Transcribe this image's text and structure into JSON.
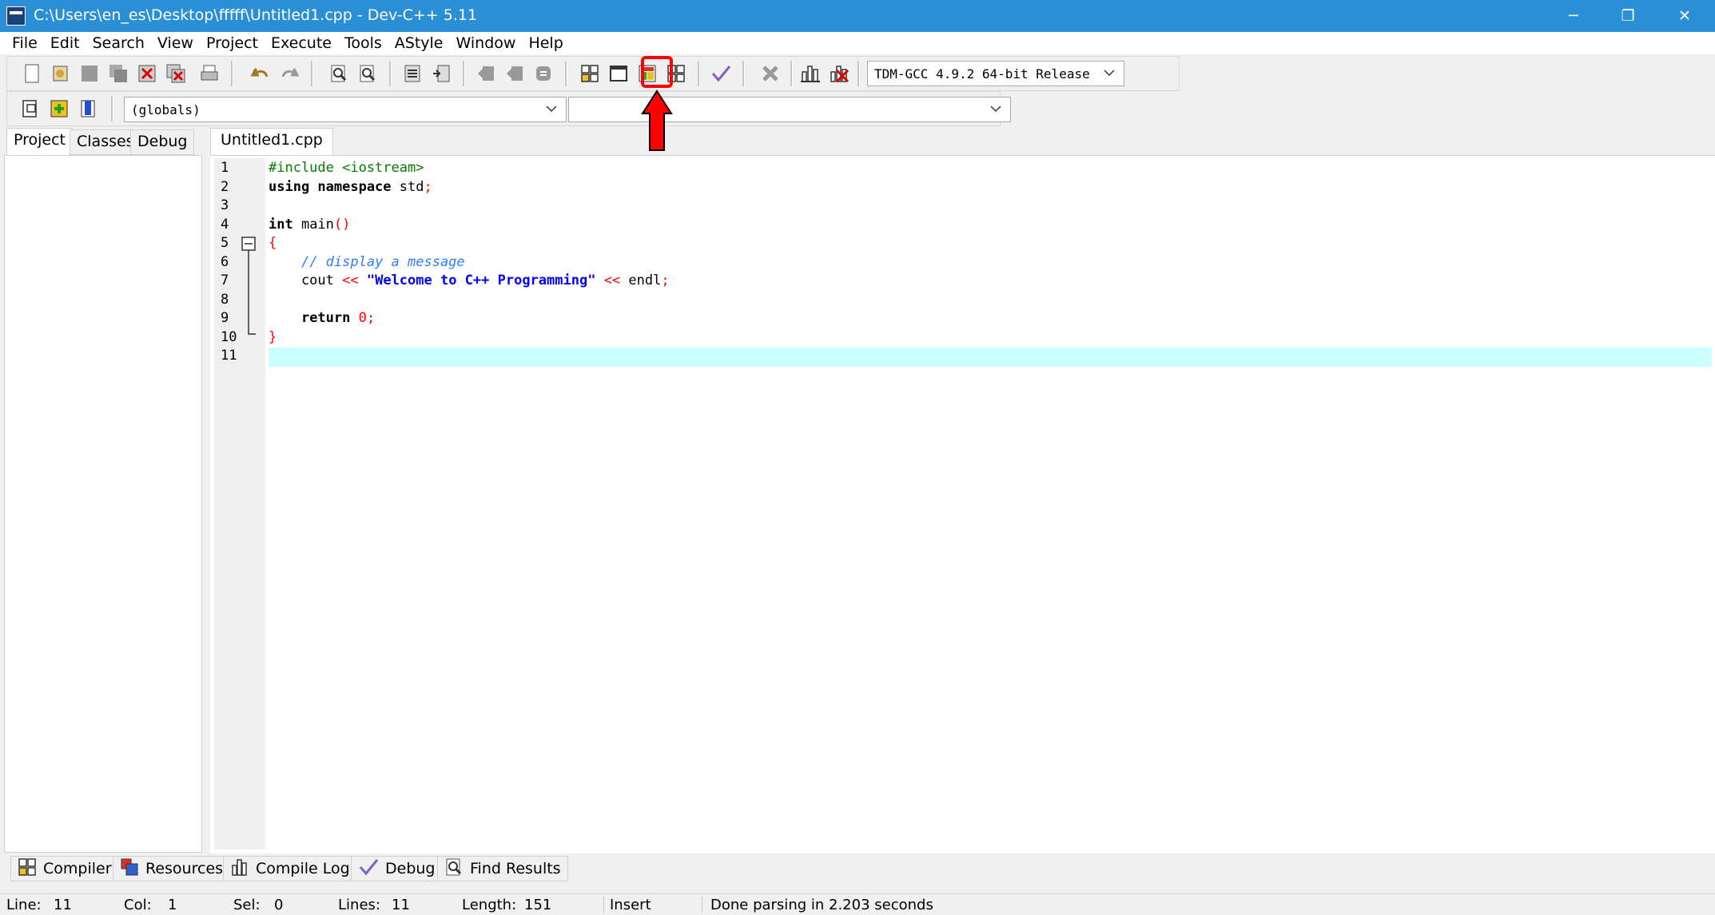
{
  "window": {
    "title": "C:\\Users\\en_es\\Desktop\\fffff\\Untitled1.cpp - Dev-C++ 5.11",
    "controls": {
      "minimize": "─",
      "restore": "❐",
      "close": "✕"
    }
  },
  "menu": [
    "File",
    "Edit",
    "Search",
    "View",
    "Project",
    "Execute",
    "Tools",
    "AStyle",
    "Window",
    "Help"
  ],
  "toolbar": {
    "compiler_select": "TDM-GCC 4.9.2 64-bit Release",
    "scope_select": "(globals)",
    "function_select": ""
  },
  "left_tabs": [
    "Project",
    "Classes",
    "Debug"
  ],
  "editor": {
    "file_tab": "Untitled1.cpp",
    "line_numbers": [
      "1",
      "2",
      "3",
      "4",
      "5",
      "6",
      "7",
      "8",
      "9",
      "10",
      "11"
    ],
    "lines": [
      {
        "tokens": [
          {
            "t": "#include <iostream>",
            "c": "pp"
          }
        ]
      },
      {
        "tokens": [
          {
            "t": "using namespace",
            "c": "kw"
          },
          {
            "t": " std",
            "c": ""
          },
          {
            "t": ";",
            "c": "op"
          }
        ]
      },
      {
        "tokens": []
      },
      {
        "tokens": [
          {
            "t": "int",
            "c": "kw"
          },
          {
            "t": " main",
            "c": ""
          },
          {
            "t": "()",
            "c": "op"
          }
        ]
      },
      {
        "tokens": [
          {
            "t": "{",
            "c": "op"
          }
        ]
      },
      {
        "tokens": [
          {
            "t": "    ",
            "c": ""
          },
          {
            "t": "// display a message",
            "c": "cm"
          }
        ]
      },
      {
        "tokens": [
          {
            "t": "    cout ",
            "c": ""
          },
          {
            "t": "<<",
            "c": "op"
          },
          {
            "t": " ",
            "c": ""
          },
          {
            "t": "\"Welcome to C++ Programming\"",
            "c": "str"
          },
          {
            "t": " ",
            "c": ""
          },
          {
            "t": "<<",
            "c": "op"
          },
          {
            "t": " endl",
            "c": ""
          },
          {
            "t": ";",
            "c": "op"
          }
        ]
      },
      {
        "tokens": []
      },
      {
        "tokens": [
          {
            "t": "    ",
            "c": ""
          },
          {
            "t": "return",
            "c": "kw"
          },
          {
            "t": " ",
            "c": ""
          },
          {
            "t": "0",
            "c": "num"
          },
          {
            "t": ";",
            "c": "op"
          }
        ]
      },
      {
        "tokens": [
          {
            "t": "}",
            "c": "op"
          }
        ]
      },
      {
        "tokens": []
      }
    ]
  },
  "bottom_tabs": [
    "Compiler",
    "Resources",
    "Compile Log",
    "Debug",
    "Find Results"
  ],
  "status": {
    "line_label": "Line:",
    "line": "11",
    "col_label": "Col:",
    "col": "1",
    "sel_label": "Sel:",
    "sel": "0",
    "lines_label": "Lines:",
    "lines": "11",
    "length_label": "Length:",
    "length": "151",
    "mode": "Insert",
    "message": "Done parsing in 2.203 seconds"
  },
  "colors": {
    "titlebar": "#2b8fd6",
    "current_line": "#ccffff",
    "annotation": "#ff0000"
  }
}
